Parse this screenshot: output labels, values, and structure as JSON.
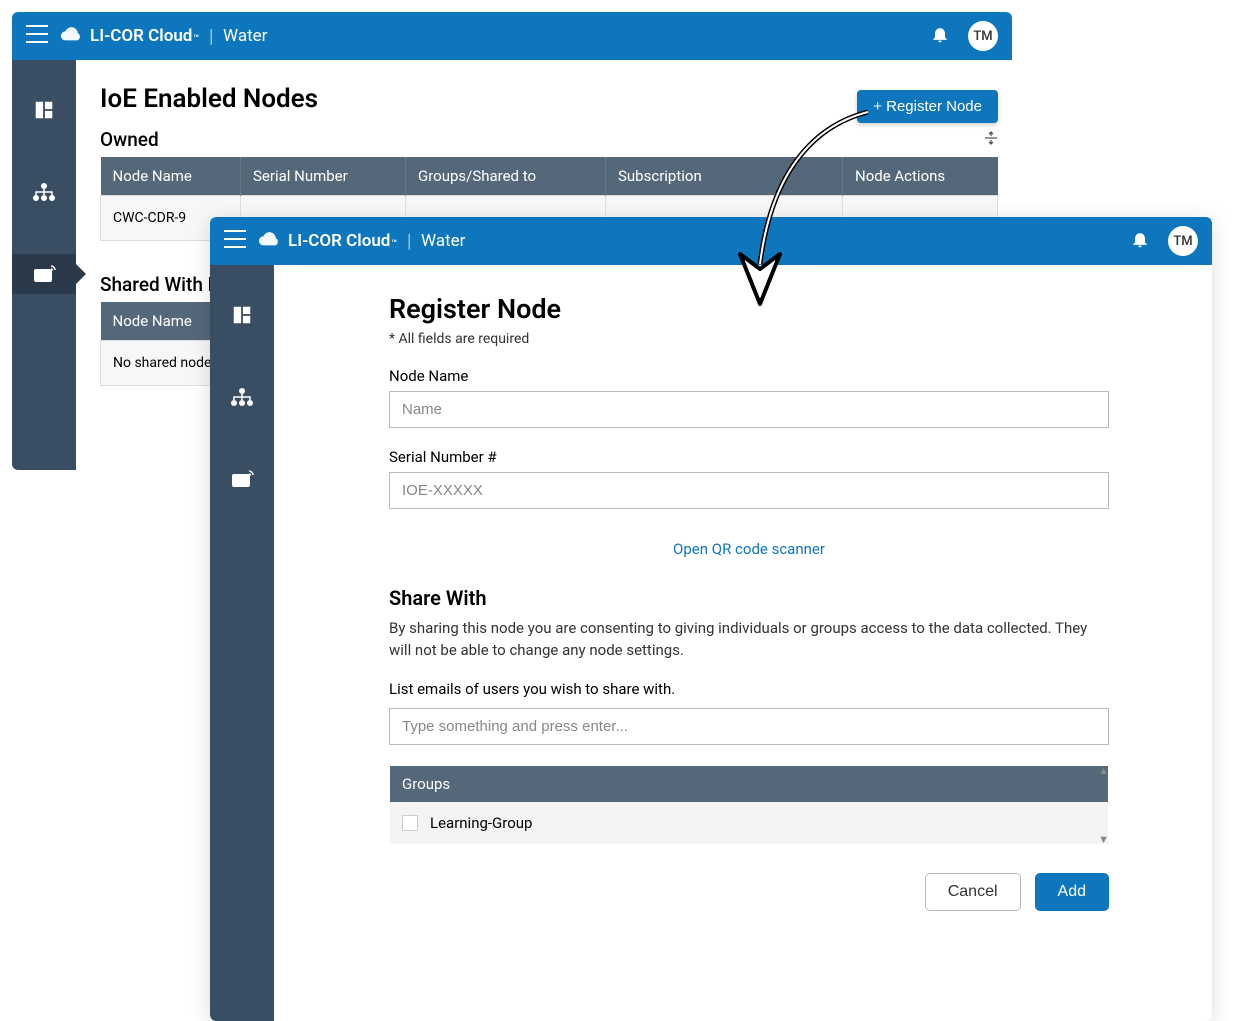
{
  "brand": {
    "name": "LI-COR Cloud",
    "tm": "™",
    "section": "Water"
  },
  "avatar": "TM",
  "layer1": {
    "title": "IoE Enabled Nodes",
    "register_btn": "+ Register Node",
    "owned": {
      "label": "Owned",
      "cols": [
        "Node Name",
        "Serial Number",
        "Groups/Shared to",
        "Subscription",
        "Node Actions"
      ],
      "row0_cell0": "CWC-CDR-9"
    },
    "shared": {
      "label": "Shared With Me",
      "cols": [
        "Node Name"
      ],
      "row0_cell0": "No shared nodes"
    }
  },
  "layer2": {
    "title": "Register Node",
    "required": "* All fields are required",
    "node_name_label": "Node Name",
    "node_name_ph": "Name",
    "serial_label": "Serial Number #",
    "serial_ph": "IOE-XXXXX",
    "qr_link": "Open QR code scanner",
    "share_h": "Share With",
    "share_desc": "By sharing this node you are consenting to giving individuals or groups access to the data collected. They will not be able to change any node settings.",
    "share_list_label": "List emails of users you wish to share with.",
    "share_input_ph": "Type something and press enter...",
    "groups_header": "Groups",
    "group_item": "Learning-Group",
    "cancel": "Cancel",
    "add": "Add"
  }
}
